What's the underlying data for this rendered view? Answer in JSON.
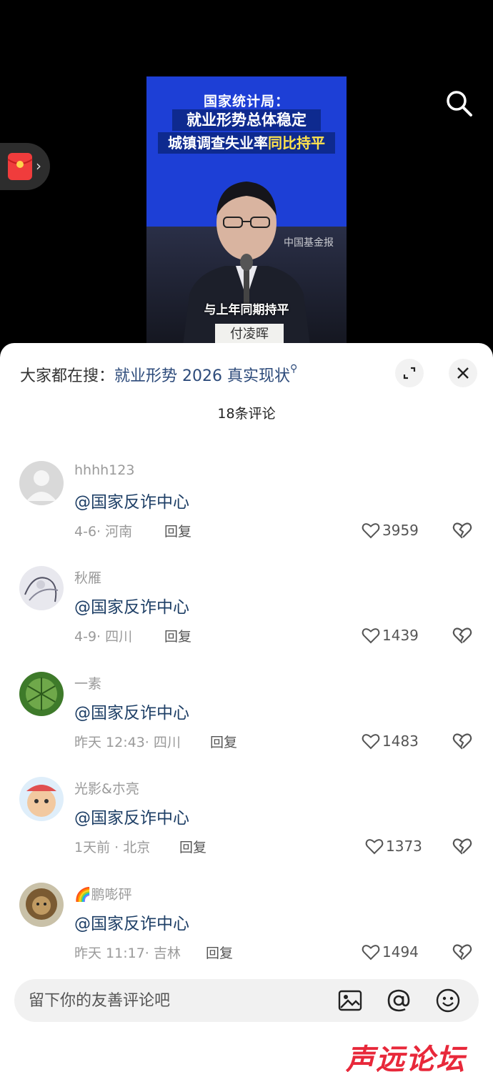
{
  "video": {
    "title_line1": "国家统计局：",
    "title_line2": "就业形势总体稳定",
    "title_line3_prefix": "城镇调查失业率",
    "title_line3_highlight": "同比持平",
    "caption": "与上年同期持平",
    "watermark": "中国基金报",
    "nameplate": "付凌晖"
  },
  "top": {
    "search_icon": "search-icon",
    "redpacket_icon": "red-packet-icon"
  },
  "sheet": {
    "hot_search_prefix": "大家都在搜：",
    "hot_search_term": "就业形势 2026 真实现状",
    "comment_count": "18条评论"
  },
  "comments": [
    {
      "user": "hhhh123",
      "text": "@国家反诈中心",
      "meta": "4-6· 河南",
      "reply": "回复",
      "likes": "3959"
    },
    {
      "user": "秋雁",
      "text": "@国家反诈中心",
      "meta": "4-9· 四川",
      "reply": "回复",
      "likes": "1439"
    },
    {
      "user": "一素",
      "text": "@国家反诈中心",
      "meta": "昨天 12:43· 四川",
      "reply": "回复",
      "likes": "1483"
    },
    {
      "user": "光影&朩亮",
      "text": "@国家反诈中心",
      "meta": "1天前 · 北京",
      "reply": "回复",
      "likes": "1373"
    },
    {
      "user": "🌈鹏嘭砰",
      "text": "@国家反诈中心",
      "meta": "昨天 11:17· 吉林",
      "reply": "回复",
      "likes": "1494"
    }
  ],
  "input": {
    "placeholder": "留下你的友善评论吧"
  },
  "watermark": "声远论坛",
  "colors": {
    "video_bg": "#1d3fd6",
    "link": "#1e3f66",
    "muted": "#9a9a9a",
    "watermark": "#e8283a"
  }
}
